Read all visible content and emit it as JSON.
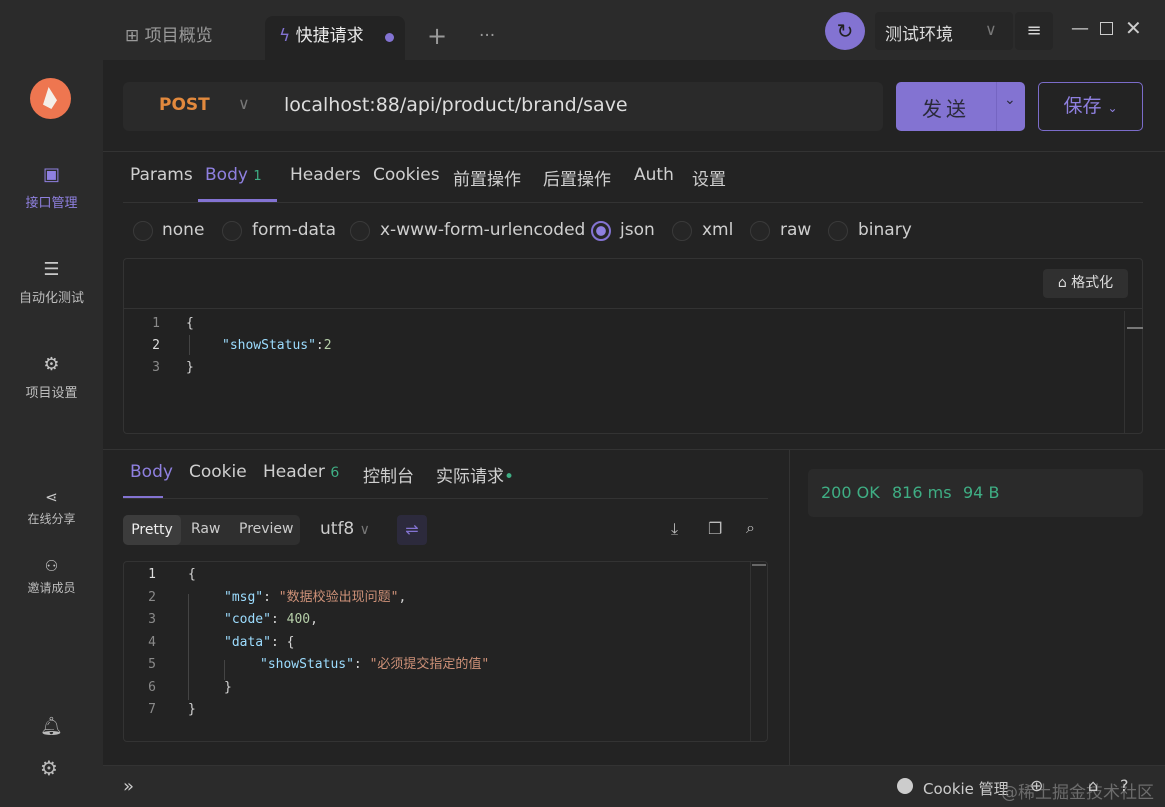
{
  "sidebar": {
    "items": [
      {
        "label": "接口管理",
        "icon": "api-icon",
        "active": true
      },
      {
        "label": "自动化测试",
        "icon": "automation-icon"
      },
      {
        "label": "项目设置",
        "icon": "settings-icon"
      },
      {
        "label": "在线分享",
        "icon": "share-icon"
      },
      {
        "label": "邀请成员",
        "icon": "invite-icon"
      }
    ]
  },
  "tabs": [
    {
      "label": "项目概览",
      "icon": "grid-icon"
    },
    {
      "label": "快捷请求",
      "icon": "lightning-icon",
      "active": true
    }
  ],
  "header": {
    "environment": "测试环境"
  },
  "request": {
    "method": "POST",
    "url": "localhost:88/api/product/brand/save",
    "send_label": "发送",
    "save_label": "保存"
  },
  "request_tabs": [
    {
      "label": "Params"
    },
    {
      "label": "Body",
      "badge": "1",
      "active": true
    },
    {
      "label": "Headers"
    },
    {
      "label": "Cookies"
    },
    {
      "label": "前置操作"
    },
    {
      "label": "后置操作"
    },
    {
      "label": "Auth"
    },
    {
      "label": "设置"
    }
  ],
  "body_types": [
    {
      "label": "none"
    },
    {
      "label": "form-data"
    },
    {
      "label": "x-www-form-urlencoded"
    },
    {
      "label": "json",
      "selected": true
    },
    {
      "label": "xml"
    },
    {
      "label": "raw"
    },
    {
      "label": "binary"
    }
  ],
  "format_label": "格式化",
  "request_body": {
    "lines": [
      "{",
      "\"showStatus\"",
      "2",
      "}"
    ]
  },
  "response_tabs": [
    {
      "label": "Body",
      "active": true
    },
    {
      "label": "Cookie"
    },
    {
      "label": "Header",
      "badge": "6"
    },
    {
      "label": "控制台"
    },
    {
      "label": "实际请求"
    }
  ],
  "view_modes": [
    {
      "label": "Pretty",
      "active": true
    },
    {
      "label": "Raw"
    },
    {
      "label": "Preview"
    }
  ],
  "encoding": "utf8",
  "response": {
    "msg_key": "\"msg\"",
    "msg": "\"数据校验出现问题\"",
    "code_key": "\"code\"",
    "code": "400",
    "data_key": "\"data\"",
    "status_key": "\"showStatus\"",
    "status_val": "\"必须提交指定的值\""
  },
  "status": {
    "code": "200 OK",
    "time": "816 ms",
    "size": "94 B",
    "color": "#3fae84"
  },
  "footer": {
    "cookie_label": "Cookie 管理",
    "watermark": "@稀土掘金技术社区"
  },
  "accent": "#8373d2"
}
